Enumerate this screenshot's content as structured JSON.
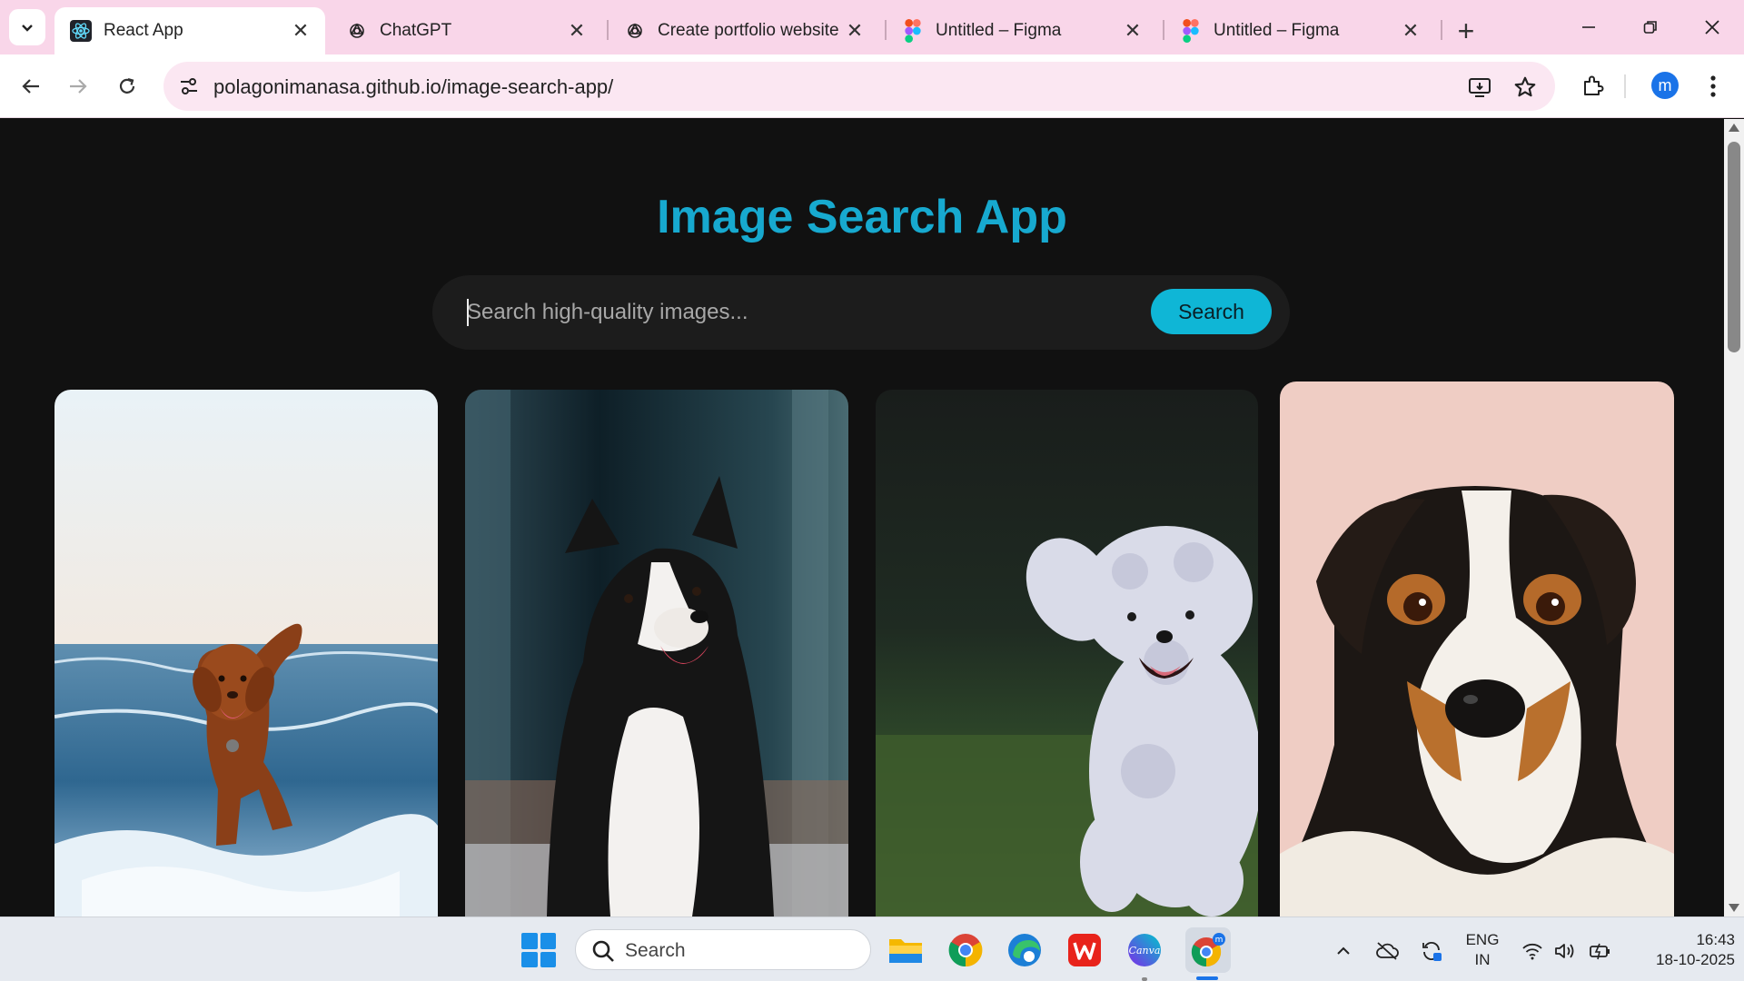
{
  "browser": {
    "tabs": [
      {
        "title": "React App",
        "active": true,
        "icon": "react-icon"
      },
      {
        "title": "ChatGPT",
        "active": false,
        "icon": "chatgpt-icon"
      },
      {
        "title": "Create portfolio website",
        "active": false,
        "icon": "chatgpt-icon"
      },
      {
        "title": "Untitled – Figma",
        "active": false,
        "icon": "figma-icon"
      },
      {
        "title": "Untitled – Figma",
        "active": false,
        "icon": "figma-icon"
      }
    ],
    "url": "polagonimanasa.github.io/image-search-app/",
    "profile_initial": "m"
  },
  "app": {
    "title": "Image Search App",
    "search_placeholder": "Search high-quality images...",
    "search_value": "",
    "search_button": "Search",
    "images": [
      {
        "subject": "brown dog running in the sea waves"
      },
      {
        "subject": "black and white border collie"
      },
      {
        "subject": "white fluffy dog running on grass"
      },
      {
        "subject": "jack russell terrier portrait"
      }
    ]
  },
  "taskbar": {
    "search_label": "Search",
    "lang_line1": "ENG",
    "lang_line2": "IN",
    "time": "16:43",
    "date": "18-10-2025",
    "accent": "#1a73e8"
  },
  "colors": {
    "tab_strip": "#f9d6e9",
    "page_bg": "#111111",
    "title": "#17a9cf",
    "search_button": "#0fb6d6"
  }
}
